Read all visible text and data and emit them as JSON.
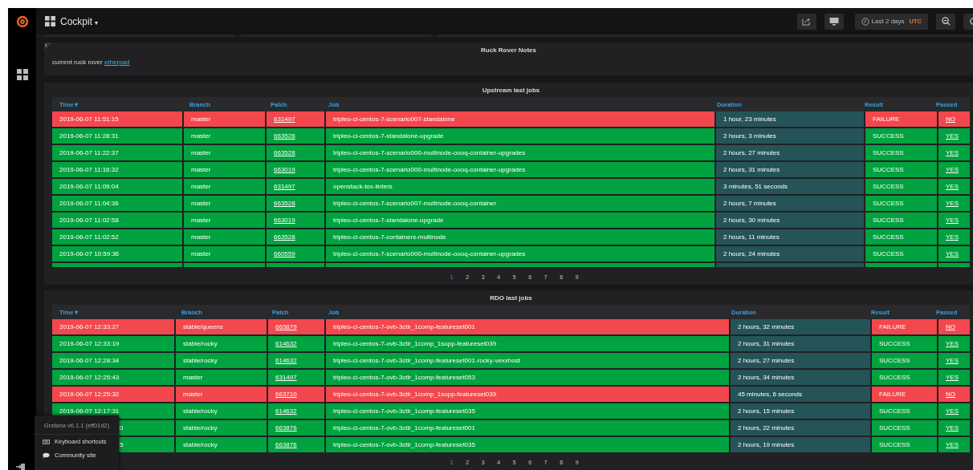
{
  "dashboard": {
    "title": "Cockpit",
    "caret": "▾"
  },
  "time_picker": {
    "label": "Last 2 days",
    "zone": "UTC"
  },
  "notes_panel": {
    "title": "Ruck Rover Notes",
    "text": "current ruck rover ",
    "link": "etherpad"
  },
  "tables": [
    {
      "title": "Upstream last jobs",
      "columns": [
        {
          "label": "Time",
          "sort_icon": "▾"
        },
        {
          "label": "Branch"
        },
        {
          "label": "Patch"
        },
        {
          "label": "Job"
        },
        {
          "label": "Duration"
        },
        {
          "label": "Result"
        },
        {
          "label": "Passed"
        }
      ],
      "rows": [
        {
          "time": "2019-06-07 11:51:15",
          "branch": "master",
          "patch": "631497",
          "job": "tripleo-ci-centos-7-scenario007-standalone",
          "duration": "1 hour, 23 minutes",
          "result": "FAILURE",
          "passed": "NO",
          "failed": true,
          "covered": false
        },
        {
          "time": "2019-06-07 11:28:31",
          "branch": "master",
          "patch": "663528",
          "job": "tripleo-ci-centos-7-standalone-upgrade",
          "duration": "2 hours, 3 minutes",
          "result": "SUCCESS",
          "passed": "YES",
          "failed": false,
          "covered": false
        },
        {
          "time": "2019-06-07 11:22:37",
          "branch": "master",
          "patch": "663528",
          "job": "tripleo-ci-centos-7-scenario000-multinode-oooq-container-upgrades",
          "duration": "2 hours, 27 minutes",
          "result": "SUCCESS",
          "passed": "YES",
          "failed": false,
          "covered": false
        },
        {
          "time": "2019-06-07 11:16:32",
          "branch": "master",
          "patch": "663019",
          "job": "tripleo-ci-centos-7-scenario000-multinode-oooq-container-upgrades",
          "duration": "2 hours, 31 minutes",
          "result": "SUCCESS",
          "passed": "YES",
          "failed": false,
          "covered": false
        },
        {
          "time": "2019-06-07 11:09:04",
          "branch": "master",
          "patch": "631497",
          "job": "openstack-tox-linters",
          "duration": "3 minutes, 51 seconds",
          "result": "SUCCESS",
          "passed": "YES",
          "failed": false,
          "covered": false
        },
        {
          "time": "2019-06-07 11:04:36",
          "branch": "master",
          "patch": "663528",
          "job": "tripleo-ci-centos-7-scenario007-multinode-oooq-container",
          "duration": "2 hours, 7 minutes",
          "result": "SUCCESS",
          "passed": "YES",
          "failed": false,
          "covered": false
        },
        {
          "time": "2019-06-07 11:02:58",
          "branch": "master",
          "patch": "663019",
          "job": "tripleo-ci-centos-7-standalone-upgrade",
          "duration": "2 hours, 30 minutes",
          "result": "SUCCESS",
          "passed": "YES",
          "failed": false,
          "covered": false
        },
        {
          "time": "2019-06-07 11:02:52",
          "branch": "master",
          "patch": "663528",
          "job": "tripleo-ci-centos-7-containers-multinode",
          "duration": "2 hours, 11 minutes",
          "result": "SUCCESS",
          "passed": "YES",
          "failed": false,
          "covered": false
        },
        {
          "time": "2019-06-07 10:59:36",
          "branch": "master",
          "patch": "660559",
          "job": "tripleo-ci-centos-7-scenario000-multinode-oooq-container-upgrades",
          "duration": "2 hours, 24 minutes",
          "result": "SUCCESS",
          "passed": "YES",
          "failed": false,
          "covered": false
        }
      ],
      "pages": [
        {
          "label": "1",
          "selected": true
        },
        {
          "label": "2",
          "selected": false
        },
        {
          "label": "3",
          "selected": false
        },
        {
          "label": "4",
          "selected": false
        },
        {
          "label": "5",
          "selected": false
        },
        {
          "label": "6",
          "selected": false
        },
        {
          "label": "7",
          "selected": false
        },
        {
          "label": "8",
          "selected": false
        },
        {
          "label": "9",
          "selected": false
        }
      ]
    },
    {
      "title": "RDO last jobs",
      "columns": [
        {
          "label": "Time",
          "sort_icon": "▾"
        },
        {
          "label": "Branch"
        },
        {
          "label": "Patch"
        },
        {
          "label": "Job"
        },
        {
          "label": "Duration"
        },
        {
          "label": "Result"
        },
        {
          "label": "Passed"
        }
      ],
      "rows": [
        {
          "time": "2019-06-07 12:33:27",
          "branch": "stable/queens",
          "patch": "663879",
          "job": "tripleo-ci-centos-7-ovb-3ctlr_1comp-featureset001",
          "duration": "2 hours, 32 minutes",
          "result": "FAILURE",
          "passed": "NO",
          "failed": true,
          "covered": false
        },
        {
          "time": "2019-06-07 12:33:19",
          "branch": "stable/rocky",
          "patch": "614632",
          "job": "tripleo-ci-centos-7-ovb-3ctlr_1comp_1supp-featureset039",
          "duration": "2 hours, 31 minutes",
          "result": "SUCCESS",
          "passed": "YES",
          "failed": false,
          "covered": false
        },
        {
          "time": "2019-06-07 12:28:34",
          "branch": "stable/rocky",
          "patch": "614632",
          "job": "tripleo-ci-centos-7-ovb-3ctlr_1comp-featureset001-rocky-vexxhost",
          "duration": "2 hours, 27 minutes",
          "result": "SUCCESS",
          "passed": "YES",
          "failed": false,
          "covered": false
        },
        {
          "time": "2019-06-07 12:25:43",
          "branch": "master",
          "patch": "631497",
          "job": "tripleo-ci-centos-7-ovb-3ctlr_1comp-featureset053",
          "duration": "2 hours, 34 minutes",
          "result": "SUCCESS",
          "passed": "YES",
          "failed": false,
          "covered": false
        },
        {
          "time": "2019-06-07 12:25:32",
          "branch": "master",
          "patch": "663710",
          "job": "tripleo-ci-centos-7-ovb-3ctlr_1comp_1supp-featureset039",
          "duration": "45 minutes, 6 seconds",
          "result": "FAILURE",
          "passed": "NO",
          "failed": true,
          "covered": false
        },
        {
          "time": "2019-06-07 12:17:31",
          "branch": "stable/rocky",
          "patch": "614632",
          "job": "tripleo-ci-centos-7-ovb-3ctlr_1comp-featureset035",
          "duration": "2 hours, 15 minutes",
          "result": "SUCCESS",
          "passed": "YES",
          "failed": false,
          "covered": false
        },
        {
          "time": "0",
          "branch": "stable/rocky",
          "patch": "663876",
          "job": "tripleo-ci-centos-7-ovb-3ctlr_1comp-featureset001",
          "duration": "2 hours, 22 minutes",
          "result": "SUCCESS",
          "passed": "YES",
          "failed": false,
          "covered": true
        },
        {
          "time": "5",
          "branch": "stable/rocky",
          "patch": "663876",
          "job": "tripleo-ci-centos-7-ovb-3ctlr_1comp-featureset035",
          "duration": "2 hours, 19 minutes",
          "result": "SUCCESS",
          "passed": "YES",
          "failed": false,
          "covered": true
        }
      ],
      "pages": [
        {
          "label": "1",
          "selected": true
        },
        {
          "label": "2",
          "selected": false
        },
        {
          "label": "3",
          "selected": false
        },
        {
          "label": "4",
          "selected": false
        },
        {
          "label": "5",
          "selected": false
        },
        {
          "label": "6",
          "selected": false
        },
        {
          "label": "7",
          "selected": false
        },
        {
          "label": "8",
          "selected": false
        },
        {
          "label": "9",
          "selected": false
        }
      ]
    }
  ],
  "help_menu": {
    "version": "Grafana v6.1.1 (eff01d2)",
    "items": [
      {
        "kind": "keyboard",
        "label": "Keyboard shortcuts"
      },
      {
        "kind": "community",
        "label": "Community site"
      }
    ]
  }
}
